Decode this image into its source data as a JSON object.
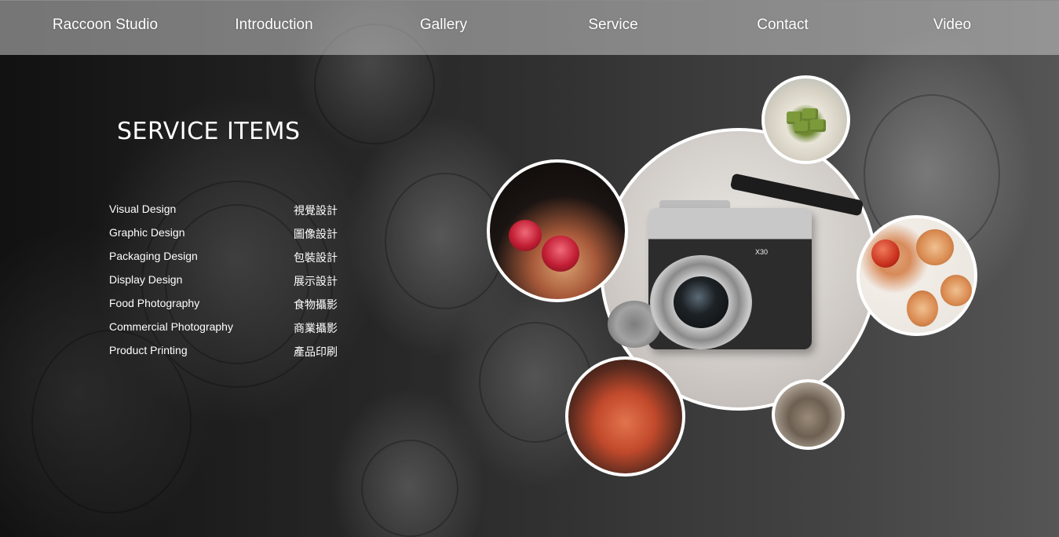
{
  "nav": {
    "items": [
      {
        "label": "Raccoon Studio"
      },
      {
        "label": "Introduction"
      },
      {
        "label": "Gallery"
      },
      {
        "label": "Service"
      },
      {
        "label": "Contact"
      },
      {
        "label": "Video"
      }
    ]
  },
  "main": {
    "heading": "SERVICE ITEMS",
    "services": [
      {
        "en": "Visual Design",
        "zh": "視覺設計"
      },
      {
        "en": "Graphic Design",
        "zh": "圖像設計"
      },
      {
        "en": "Packaging Design",
        "zh": "包裝設計"
      },
      {
        "en": "Display Design",
        "zh": "展示設計"
      },
      {
        "en": "Food Photography",
        "zh": "食物攝影"
      },
      {
        "en": "Commercial Photography",
        "zh": "商業攝影"
      },
      {
        "en": "Product Printing",
        "zh": "產品印刷"
      }
    ]
  },
  "photos": {
    "camera_model": "X30"
  },
  "colors": {
    "nav_overlay": "#c8c8c8",
    "text": "#ffffff",
    "circle_border": "#ffffff"
  }
}
